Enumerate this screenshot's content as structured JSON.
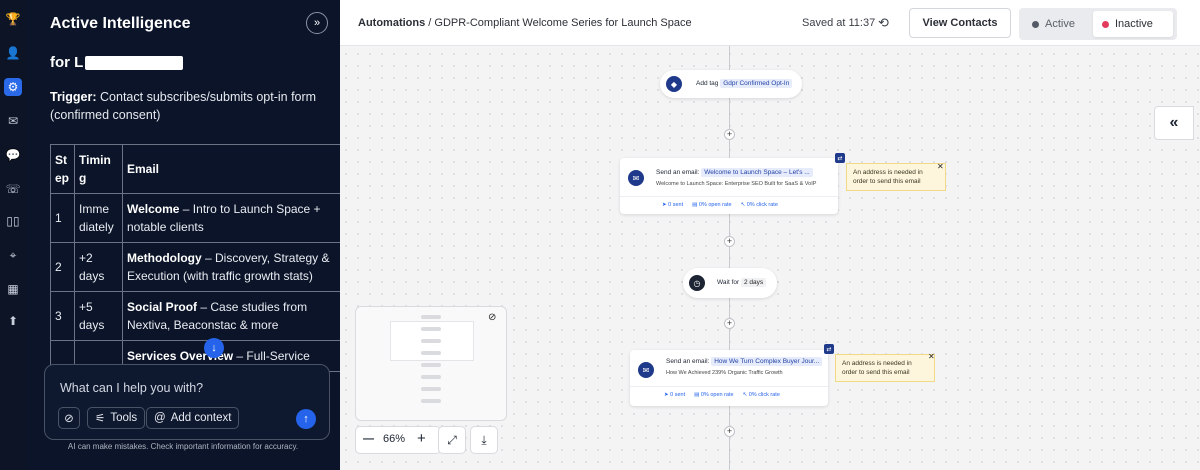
{
  "rail": {
    "icons": [
      "trophy-icon",
      "user-icon",
      "automations-icon",
      "mail-icon",
      "chat-icon",
      "whatsapp-icon",
      "pipeline-icon",
      "cursor-icon",
      "reports-icon",
      "upload-icon"
    ]
  },
  "assistant": {
    "title": "Active Intelligence",
    "for_prefix": "for L",
    "trigger_label": "Trigger:",
    "trigger_text": "Contact subscribes/submits opt-in form (confirmed consent)",
    "table": {
      "headers": [
        "St ep",
        "Timin g",
        "Email"
      ],
      "rows": [
        {
          "step": "1",
          "timing": "Imme diately",
          "title": "Welcome",
          "desc": " – Intro to Launch Space + notable clients"
        },
        {
          "step": "2",
          "timing": "+2 days",
          "title": "Methodology",
          "desc": " – Discovery, Strategy & Execution (with traffic growth stats)"
        },
        {
          "step": "3",
          "timing": "+5 days",
          "title": "Social Proof",
          "desc": " – Case studies from Nextiva, Beaconstac & more"
        },
        {
          "step": "",
          "timing": "",
          "title": "Services Overview",
          "desc": " – Full-Service"
        }
      ]
    },
    "chat": {
      "placeholder": "What can I help you with?",
      "tools_label": "Tools",
      "add_context_label": "Add context",
      "disclaimer": "AI can make mistakes. Check important information for accuracy."
    }
  },
  "topbar": {
    "breadcrumb_root": "Automations",
    "breadcrumb_sep": " / ",
    "breadcrumb_page": "GDPR-Compliant Welcome Series for Launch Space",
    "saved": "Saved at 11:37",
    "view_contacts": "View Contacts",
    "status_active": "Active",
    "status_inactive": "Inactive",
    "colors": {
      "active_dot": "#555b66",
      "inactive_dot": "#e23b5c"
    }
  },
  "flow": {
    "add_tag": {
      "label": "Add tag",
      "tag": "Gdpr Confirmed Opt-In"
    },
    "email1": {
      "label": "Send an email:",
      "subject": "Welcome to Launch Space – Let's ...",
      "preview": "Welcome to Launch Space: Enterprise SEO Built for SaaS & VoIP",
      "sent": "0 sent",
      "open_rate": "0% open rate",
      "click_rate": "0% click rate"
    },
    "warning1": "An address is needed in order to send this email",
    "wait": {
      "label": "Wait for",
      "value": "2 days"
    },
    "email2": {
      "label": "Send an email:",
      "subject": "How We Turn Complex Buyer Jour...",
      "preview": "How We Achieved 239% Organic Traffic Growth",
      "sent": "0 sent",
      "open_rate": "0% open rate",
      "click_rate": "0% click rate"
    },
    "warning2": "An address is needed in order to send this email"
  },
  "controls": {
    "zoom": "66%"
  }
}
